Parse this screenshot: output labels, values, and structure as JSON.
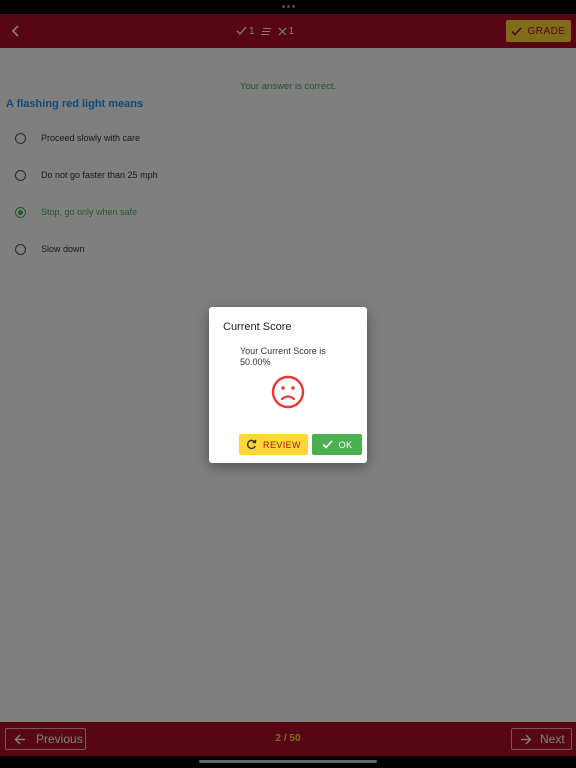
{
  "header": {
    "correct_count": "1",
    "wrong_count": "1",
    "grade_label": "GRADE"
  },
  "question": {
    "feedback": "Your answer is correct.",
    "text": "A flashing red light means",
    "options": [
      {
        "label": "Proceed slowly with care",
        "selected": false
      },
      {
        "label": "Do not go faster than 25 mph",
        "selected": false
      },
      {
        "label": "Stop, go only when safe",
        "selected": true
      },
      {
        "label": "Slow down",
        "selected": false
      }
    ]
  },
  "footer": {
    "previous_label": "Previous",
    "page_indicator": "2 / 50",
    "next_label": "Next"
  },
  "dialog": {
    "title": "Current Score",
    "message": "Your Current Score is 50.00%",
    "icon": "sad-face-icon",
    "review_label": "REVIEW",
    "ok_label": "OK"
  },
  "colors": {
    "brand_red": "#b00d27",
    "accent_yellow": "#fdd835",
    "correct_green": "#4caf50",
    "question_blue": "#2196f3",
    "sad_face_red": "#e53935"
  }
}
